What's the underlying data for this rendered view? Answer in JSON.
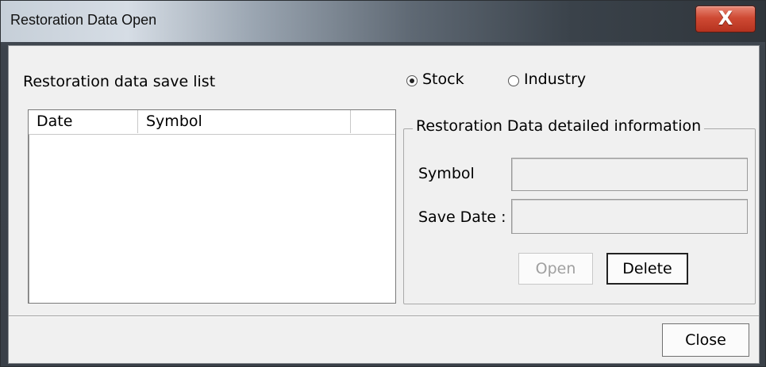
{
  "window": {
    "title": "Restoration Data Open",
    "close_glyph": "X"
  },
  "left": {
    "list_label": "Restoration data save list",
    "columns": [
      "Date",
      "Symbol",
      ""
    ]
  },
  "mode": {
    "options": [
      {
        "label": "Stock",
        "selected": true
      },
      {
        "label": "Industry",
        "selected": false
      }
    ]
  },
  "details": {
    "group_title": "Restoration Data detailed information",
    "symbol_label": "Symbol",
    "symbol_value": "",
    "save_date_label": "Save Date :",
    "save_date_value": ""
  },
  "buttons": {
    "open": "Open",
    "delete": "Delete",
    "close": "Close"
  }
}
